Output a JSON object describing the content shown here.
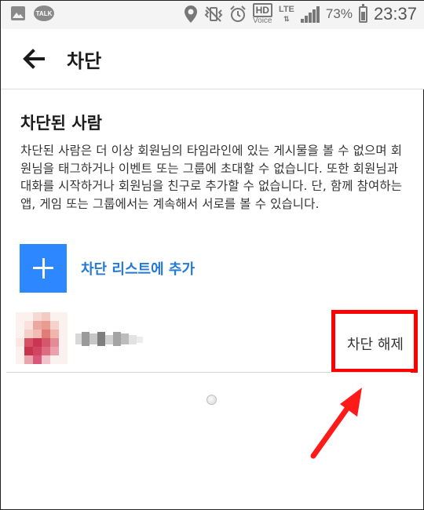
{
  "status_bar": {
    "talk_badge": "TALK",
    "hd": "HD",
    "voice": "Voice",
    "network": "LTE",
    "battery": "73%",
    "time": "23:37",
    "battery_level": 0.73
  },
  "app_bar": {
    "title": "차단"
  },
  "blocked_section": {
    "title": "차단된 사람",
    "description": "차단된 사람은 더 이상 회원님의 타임라인에 있는 게시물을 볼 수 없으며 회원님을 태그하거나 이벤트 또는 그룹에 초대할 수 없습니다. 또한 회원님과 대화를 시작하거나 회원님을 친구로 추가할 수 없습니다. 단, 함께 참여하는 앱, 게임 또는 그룹에서는 계속해서 서로를 볼 수 있습니다.",
    "add_label": "차단 리스트에 추가",
    "blocked_people": [
      {
        "unblock_label": "차단 해제"
      }
    ]
  },
  "colors": {
    "accent": "#2d88ff",
    "link": "#2379d6",
    "annotation": "#ff0000"
  }
}
